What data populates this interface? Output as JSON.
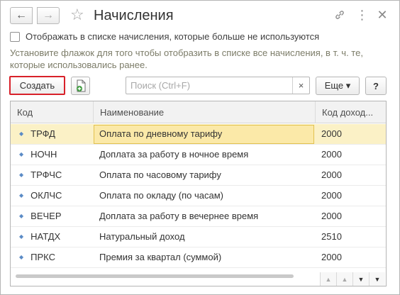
{
  "window": {
    "title": "Начисления",
    "icons": [
      "back-arrow-icon",
      "forward-arrow-icon",
      "favorite-star-icon",
      "link-icon",
      "more-vertical-icon",
      "close-icon"
    ]
  },
  "filter": {
    "show_unused_label": "Отображать в списке начисления, которые больше не используются",
    "checked": false,
    "hint": "Установите флажок для того чтобы отобразить в списке все начисления, в т. ч. те, которые использовались ранее."
  },
  "toolbar": {
    "create_label": "Создать",
    "search_placeholder": "Поиск (Ctrl+F)",
    "search_clear": "×",
    "more_label": "Еще ▾",
    "help_label": "?"
  },
  "table": {
    "columns": [
      "Код",
      "Наименование",
      "Код доход..."
    ],
    "rows": [
      {
        "code": "ТРФД",
        "name": "Оплата по дневному тарифу",
        "income": "2000",
        "selected": true
      },
      {
        "code": "НОЧН",
        "name": "Доплата за работу в ночное время",
        "income": "2000"
      },
      {
        "code": "ТРФЧС",
        "name": "Оплата по часовому тарифу",
        "income": "2000"
      },
      {
        "code": "ОКЛЧС",
        "name": "Оплата по окладу (по часам)",
        "income": "2000"
      },
      {
        "code": "ВЕЧЕР",
        "name": "Доплата за работу в вечернее время",
        "income": "2000"
      },
      {
        "code": "НАТДХ",
        "name": "Натуральный доход",
        "income": "2510"
      },
      {
        "code": "ПРКС",
        "name": "Премия за квартал (суммой)",
        "income": "2000"
      }
    ]
  },
  "colors": {
    "accent_red": "#d8212a",
    "selected_row": "#fbf1c6",
    "row_marker": "#5b8bc6",
    "hint_text": "#7c7c68"
  }
}
